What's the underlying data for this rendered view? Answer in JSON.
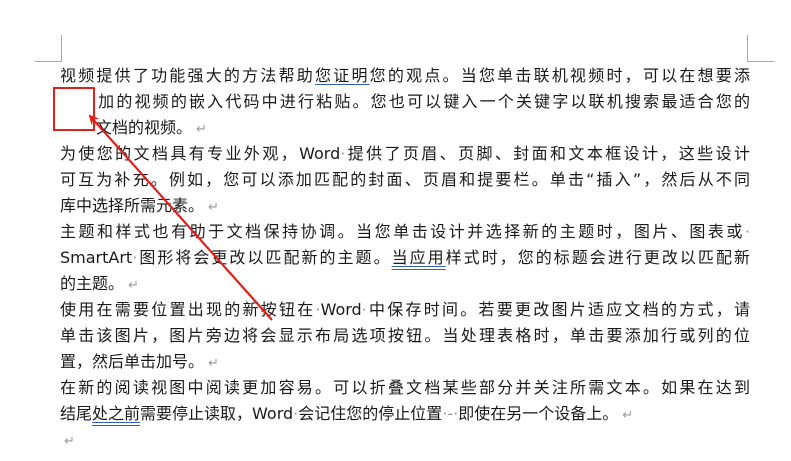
{
  "document": {
    "paragraphs": [
      {
        "lines": [
          {
            "segments": [
              {
                "t": "视频提供了功能强大的方法帮助"
              },
              {
                "t": "您证明",
                "u": "blue"
              },
              {
                "t": "您的观点。当您单击联机视频时，可以在想要添"
              }
            ]
          },
          {
            "segments": [
              {
                "t": "加的视频的嵌入代码中进行粘贴。您也可以键入一个关键字以联机搜索最适合您的"
              }
            ],
            "indent": true
          },
          {
            "segments": [
              {
                "t": "文档的视频。"
              }
            ],
            "indent": true,
            "mark": "↵"
          }
        ]
      },
      {
        "lines": [
          {
            "segments": [
              {
                "t": "为使您的文档具有专业外观，Word"
              },
              {
                "t": "·",
                "dot": true
              },
              {
                "t": "提供了页眉、页脚、封面和文本框设计，这些设计"
              }
            ]
          },
          {
            "segments": [
              {
                "t": "可互为补充。例如，您可以添加匹配的封面、页眉和提要栏。单击“插入”，然后从不同"
              }
            ]
          },
          {
            "segments": [
              {
                "t": "库中选择所需元素。"
              }
            ],
            "mark": "↵"
          }
        ]
      },
      {
        "lines": [
          {
            "segments": [
              {
                "t": "主题和样式也有助于文档保持协调。当您单击设计并选择新的主题时，图片、图表或"
              },
              {
                "t": "·",
                "dot": true
              }
            ]
          },
          {
            "segments": [
              {
                "t": "SmartArt"
              },
              {
                "t": "·",
                "dot": true
              },
              {
                "t": "图形将会更改以匹配新的主题。"
              },
              {
                "t": "当应用",
                "u": "dbl"
              },
              {
                "t": "样式时，您的标题会进行更改以匹配新"
              }
            ]
          },
          {
            "segments": [
              {
                "t": "的主题。"
              }
            ],
            "mark": "↵"
          }
        ]
      },
      {
        "lines": [
          {
            "segments": [
              {
                "t": "使用在需要位置出现的新按钮在"
              },
              {
                "t": "·",
                "dot": true
              },
              {
                "t": "Word"
              },
              {
                "t": "·",
                "dot": true
              },
              {
                "t": "中保存时间。若要更改图片适应文档的方式，请"
              }
            ]
          },
          {
            "segments": [
              {
                "t": "单击该图片，图片旁边将会显示布局选项按钮。当处理表格时，单击要添加行或列的位"
              }
            ]
          },
          {
            "segments": [
              {
                "t": "置，然后单击加号。"
              }
            ],
            "mark": "↵"
          }
        ]
      },
      {
        "lines": [
          {
            "segments": [
              {
                "t": "在新的阅读视图中阅读更加容易。可以折叠文档某些部分并关注所需文本。如果在达到"
              }
            ]
          },
          {
            "segments": [
              {
                "t": "结尾"
              },
              {
                "t": "处之前",
                "u": "dbl"
              },
              {
                "t": "需要停止读取，Word"
              },
              {
                "t": "·",
                "dot": true
              },
              {
                "t": "会记住您的停止位置"
              },
              {
                "t": "·-·",
                "dot": true
              },
              {
                "t": "即使在另一个设备上。"
              }
            ],
            "mark": "↵"
          }
        ]
      },
      {
        "lines": [
          {
            "segments": [],
            "mark": "↵"
          }
        ]
      }
    ]
  },
  "annotation": {
    "box_color": "#e0201b",
    "arrow_color": "#e0201b"
  }
}
